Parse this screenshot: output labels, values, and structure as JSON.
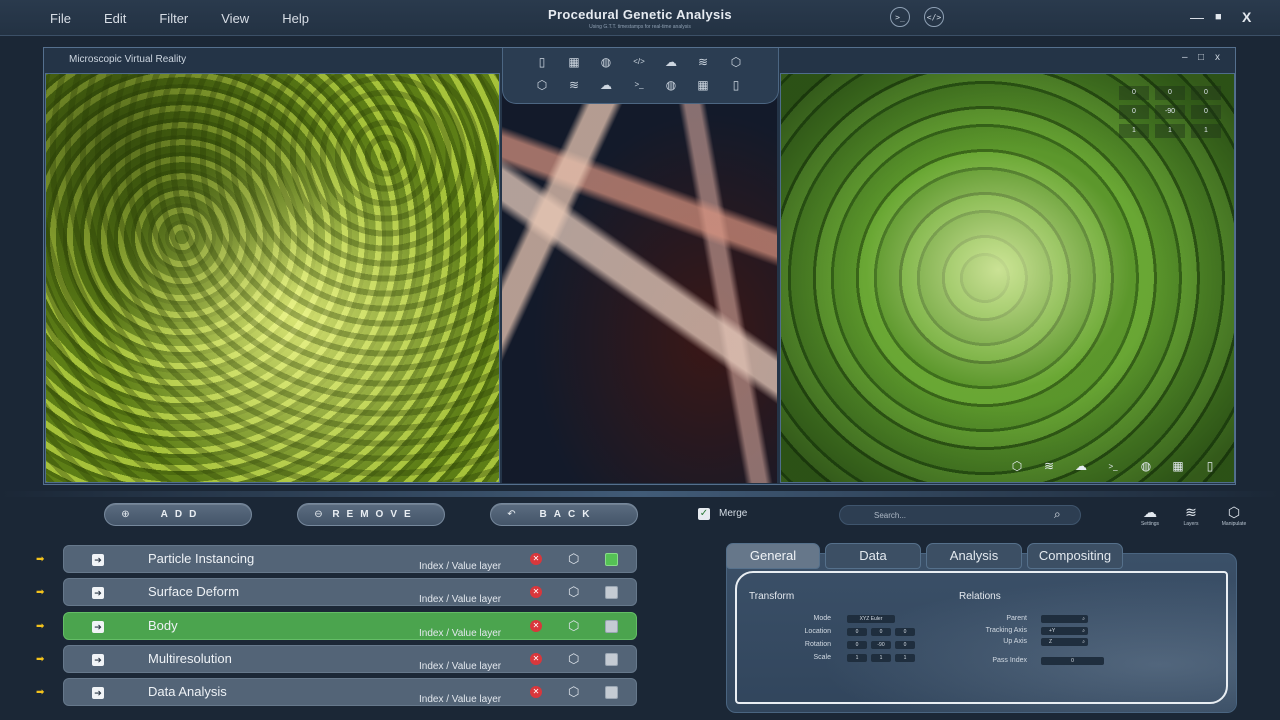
{
  "app": {
    "title": "Procedural Genetic Analysis",
    "subtitle": "Using G.T.T. timestamps for real-time analysis"
  },
  "menu": [
    "File",
    "Edit",
    "Filter",
    "View",
    "Help"
  ],
  "top_icons": [
    {
      "name": "terminal-icon",
      "glyph": ">_"
    },
    {
      "name": "code-icon",
      "glyph": "</>"
    }
  ],
  "window_controls": {
    "minimize": "—",
    "maximize": "■",
    "close": "X"
  },
  "viewport": {
    "title": "Microscopic Virtual Reality",
    "controls": {
      "minimize": "–",
      "maximize": "□",
      "close": "x"
    },
    "toolbar_row1": [
      "document-icon",
      "qr-icon",
      "globe-icon",
      "code-icon",
      "cloud-icon",
      "layers-icon",
      "cube-icon"
    ],
    "toolbar_row2": [
      "cube-icon",
      "layers-icon",
      "cloud-icon",
      "terminal-icon",
      "globe-icon",
      "qr-icon",
      "document-icon"
    ],
    "transform_matrix": [
      [
        "0",
        "0",
        "0"
      ],
      [
        "0",
        "-90",
        "0"
      ],
      [
        "1",
        "1",
        "1"
      ]
    ],
    "bottom_icons": [
      "cube-icon",
      "layers-icon",
      "cloud-icon",
      "terminal-icon",
      "globe-icon",
      "qr-icon",
      "document-icon"
    ]
  },
  "actions": {
    "add": "ADD",
    "remove": "REMOVE",
    "back": "BACK",
    "merge_label": "Merge",
    "merge_checked": true,
    "search_placeholder": "Search..."
  },
  "tool_groups": [
    {
      "label": "Settings",
      "icon": "cloud-icon"
    },
    {
      "label": "Layers",
      "icon": "layers-icon"
    },
    {
      "label": "Manipulate",
      "icon": "cube-icon"
    }
  ],
  "modifiers": [
    {
      "name": "Particle Instancing",
      "sub": "Index / Value layer",
      "enabled": true,
      "active": false
    },
    {
      "name": "Surface Deform",
      "sub": "Index / Value layer",
      "enabled": false,
      "active": false
    },
    {
      "name": "Body",
      "sub": "Index / Value layer",
      "enabled": false,
      "active": true
    },
    {
      "name": "Multiresolution",
      "sub": "Index / Value layer",
      "enabled": false,
      "active": false
    },
    {
      "name": "Data Analysis",
      "sub": "Index / Value layer",
      "enabled": false,
      "active": false
    }
  ],
  "properties": {
    "tabs": [
      "General",
      "Data",
      "Analysis",
      "Compositing"
    ],
    "active_tab": "General",
    "transform": {
      "title": "Transform",
      "mode_label": "Mode",
      "mode_value": "XYZ Euler",
      "location_label": "Location",
      "location": [
        "0",
        "0",
        "0"
      ],
      "rotation_label": "Rotation",
      "rotation": [
        "0",
        "-90",
        "0"
      ],
      "scale_label": "Scale",
      "scale": [
        "1",
        "1",
        "1"
      ]
    },
    "relations": {
      "title": "Relations",
      "parent_label": "Parent",
      "parent_value": "",
      "tracking_label": "Tracking Axis",
      "tracking_value": "+Y",
      "up_label": "Up Axis",
      "up_value": "Z",
      "pass_label": "Pass Index",
      "pass_value": "0"
    }
  }
}
